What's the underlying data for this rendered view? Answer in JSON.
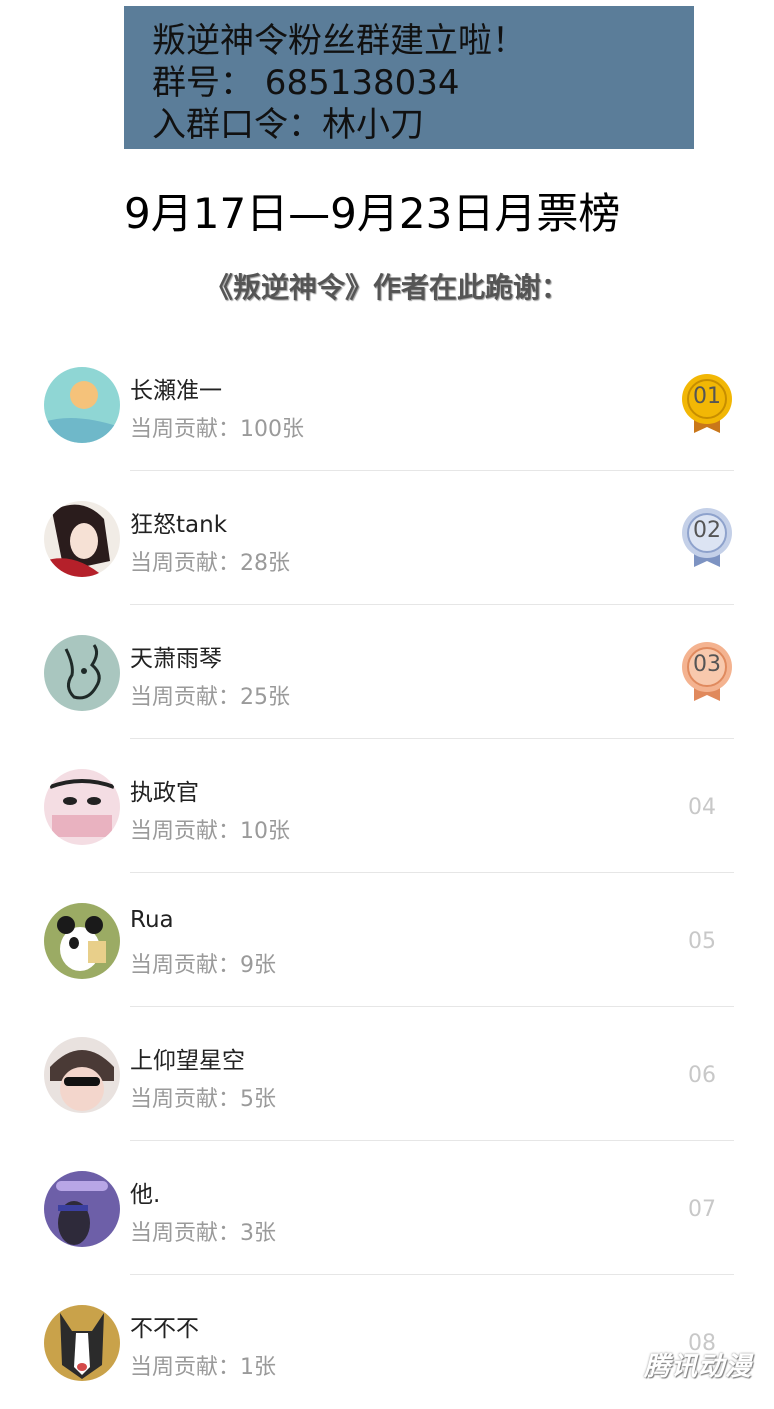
{
  "banner": {
    "line1": "叛逆神令粉丝群建立啦！",
    "line2": "群号： 685138034",
    "line3": "入群口令：林小刀",
    "color": "#5b7d99"
  },
  "headline": "9月17日—9月23日月票榜",
  "thanks": "《叛逆神令》作者在此跪谢：",
  "ranking": [
    {
      "name": "长瀬准一",
      "contribution": "当周贡献：100张",
      "rank": "01",
      "medal": "gold"
    },
    {
      "name": "狂怒tank",
      "contribution": "当周贡献：28张",
      "rank": "02",
      "medal": "silver"
    },
    {
      "name": "天萧雨琴",
      "contribution": "当周贡献：25张",
      "rank": "03",
      "medal": "bronze"
    },
    {
      "name": "执政官",
      "contribution": "当周贡献：10张",
      "rank": "04"
    },
    {
      "name": "Rua",
      "contribution": "当周贡献：9张",
      "rank": "05"
    },
    {
      "name": "上仰望星空",
      "contribution": "当周贡献：5张",
      "rank": "06"
    },
    {
      "name": "他.",
      "contribution": "当周贡献：3张",
      "rank": "07"
    },
    {
      "name": "不不不",
      "contribution": "当周贡献：1张",
      "rank": "08"
    }
  ],
  "medal_colors": {
    "gold": "#f2b705",
    "silver": "#a9b9d8",
    "bronze": "#f0a77c"
  },
  "watermark": "腾讯动漫"
}
